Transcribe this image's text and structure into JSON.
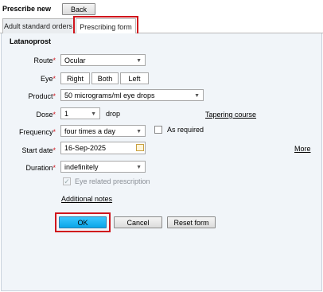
{
  "header": {
    "title": "Prescribe new",
    "back_label": "Back"
  },
  "tabs": [
    {
      "label": "Adult standard orders"
    },
    {
      "label": "Prescribing form"
    }
  ],
  "form": {
    "drug_name": "Latanoprost",
    "route": {
      "label": "Route",
      "value": "Ocular"
    },
    "eye": {
      "label": "Eye",
      "options": [
        "Right",
        "Both",
        "Left"
      ]
    },
    "product": {
      "label": "Product",
      "value": "50 micrograms/ml eye drops"
    },
    "dose": {
      "label": "Dose",
      "value": "1",
      "unit": "drop",
      "tapering_link": "Tapering course"
    },
    "frequency": {
      "label": "Frequency",
      "value": "four times a day",
      "as_required_label": "As required"
    },
    "start_date": {
      "label": "Start date",
      "value": "16-Sep-2025",
      "more_link": "More"
    },
    "duration": {
      "label": "Duration",
      "value": "indefinitely"
    },
    "eye_related_label": "Eye related prescription",
    "additional_notes_link": "Additional notes"
  },
  "actions": {
    "ok": "OK",
    "cancel": "Cancel",
    "reset": "Reset form"
  },
  "colors": {
    "highlight": "#d0141c",
    "ok_button": "#19b3f0",
    "panel_bg": "#f1f5f9"
  }
}
